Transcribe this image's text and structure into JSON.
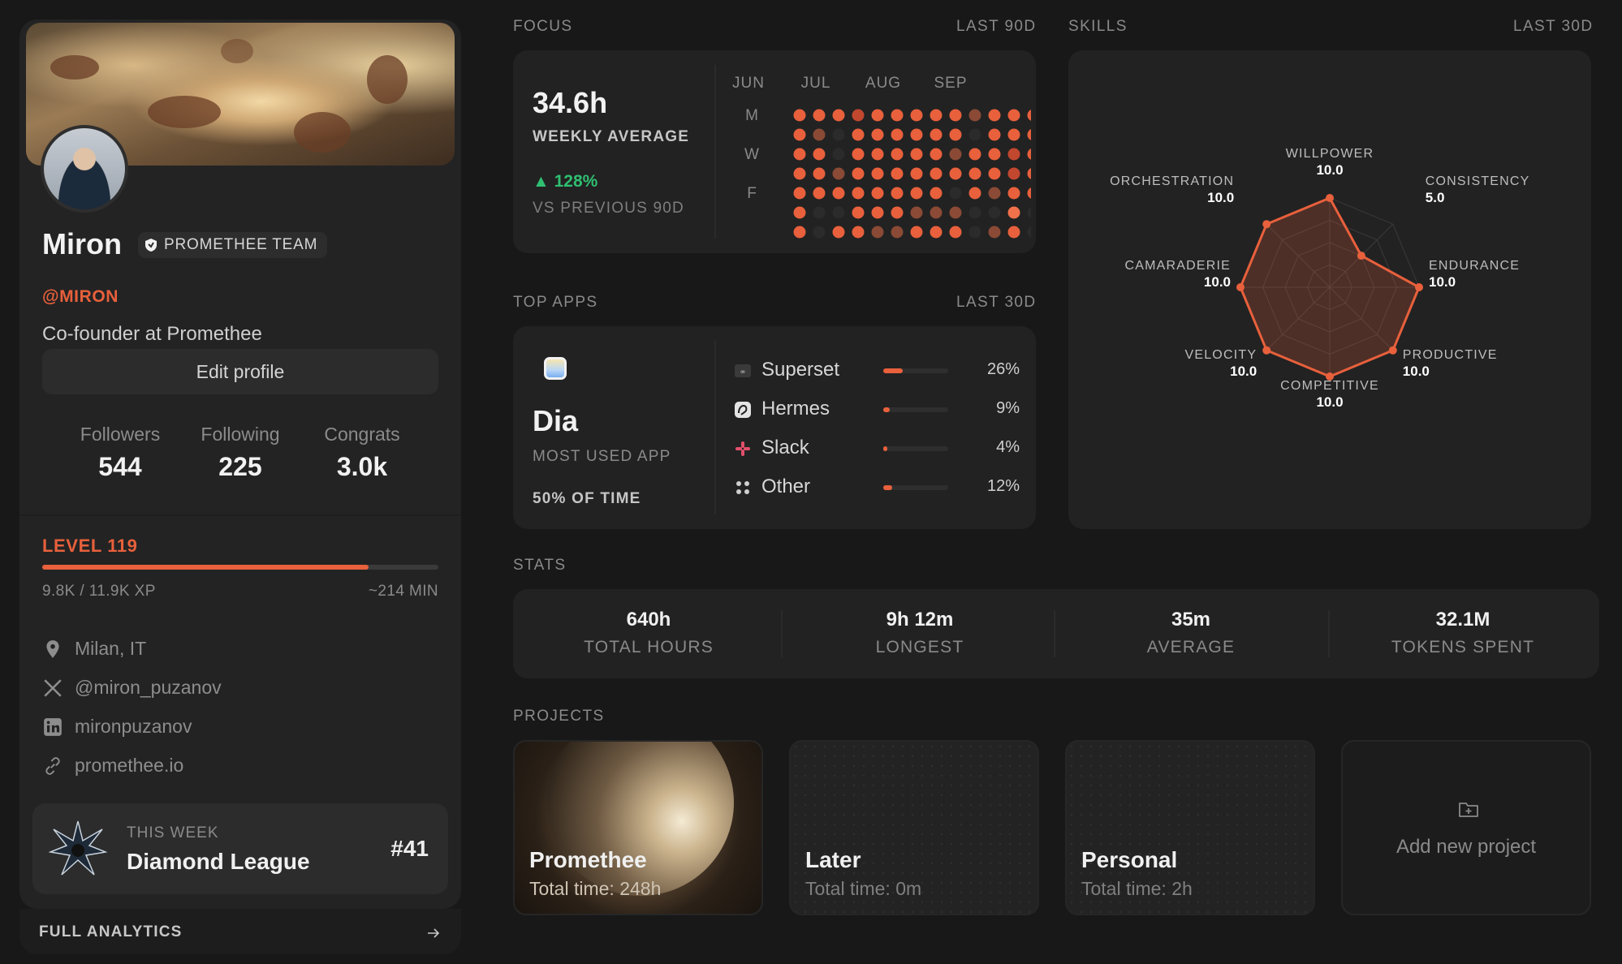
{
  "profile": {
    "name": "Miron",
    "team": "PROMETHEE TEAM",
    "handle": "@MIRON",
    "bio": "Co-founder at Promethee",
    "edit_label": "Edit profile",
    "stats": [
      {
        "label": "Followers",
        "value": "544"
      },
      {
        "label": "Following",
        "value": "225"
      },
      {
        "label": "Congrats",
        "value": "3.0k"
      }
    ],
    "level": "LEVEL 119",
    "xp_text": "9.8K / 11.9K XP",
    "xp_progress": 0.824,
    "xp_time": "~214 MIN",
    "links": [
      {
        "icon": "location-pin-icon",
        "text": "Milan, IT"
      },
      {
        "icon": "x-logo-icon",
        "text": "@miron_puzanov"
      },
      {
        "icon": "linkedin-icon",
        "text": "mironpuzanov"
      },
      {
        "icon": "link-icon",
        "text": "promethee.io"
      }
    ],
    "league": {
      "kicker": "THIS WEEK",
      "name": "Diamond League",
      "rank": "#41"
    },
    "analytics_label": "FULL ANALYTICS"
  },
  "focus": {
    "title": "FOCUS",
    "range": "LAST 90D",
    "value": "34.6h",
    "label": "WEEKLY AVERAGE",
    "delta": "▲ 128%",
    "compare": "VS PREVIOUS 90D",
    "months": [
      "JUN",
      "JUL",
      "AUG",
      "SEP"
    ],
    "day_labels": [
      "M",
      "",
      "W",
      "",
      "F",
      ""
    ],
    "grid": [
      [
        3,
        3,
        3,
        2,
        3,
        3,
        3,
        3,
        3,
        1,
        3,
        3,
        3
      ],
      [
        3,
        1,
        0,
        3,
        3,
        3,
        3,
        3,
        3,
        0,
        3,
        3,
        3
      ],
      [
        3,
        3,
        0,
        3,
        3,
        3,
        3,
        3,
        1,
        3,
        3,
        2,
        3
      ],
      [
        3,
        3,
        1,
        3,
        3,
        3,
        3,
        3,
        3,
        3,
        3,
        2,
        3
      ],
      [
        3,
        3,
        3,
        3,
        3,
        3,
        3,
        3,
        0,
        3,
        1,
        3,
        3
      ],
      [
        3,
        0,
        0,
        3,
        3,
        3,
        1,
        1,
        1,
        0,
        0,
        4,
        0
      ],
      [
        3,
        0,
        3,
        3,
        1,
        1,
        3,
        3,
        3,
        0,
        1,
        3,
        0
      ]
    ],
    "colors": [
      "#2b2b2b",
      "#8a4a35",
      "#c2472f",
      "#e8603c",
      "#f1714a"
    ]
  },
  "top_apps": {
    "title": "TOP APPS",
    "range": "LAST 30D",
    "top_name": "Dia",
    "top_label": "MOST USED APP",
    "top_share": "50% OF TIME",
    "apps": [
      {
        "name": "Superset",
        "pct": "26%",
        "value": 0.26,
        "icon": "superset-icon"
      },
      {
        "name": "Hermes",
        "pct": "9%",
        "value": 0.09,
        "icon": "hermes-icon"
      },
      {
        "name": "Slack",
        "pct": "4%",
        "value": 0.04,
        "icon": "slack-icon"
      },
      {
        "name": "Other",
        "pct": "12%",
        "value": 0.12,
        "icon": "other-apps-icon"
      }
    ]
  },
  "skills": {
    "title": "SKILLS",
    "range": "LAST 30D",
    "axes": [
      {
        "name": "WILLPOWER",
        "value": "10.0",
        "v": 10
      },
      {
        "name": "CONSISTENCY",
        "value": "5.0",
        "v": 5
      },
      {
        "name": "ENDURANCE",
        "value": "10.0",
        "v": 10
      },
      {
        "name": "PRODUCTIVE",
        "value": "10.0",
        "v": 10
      },
      {
        "name": "COMPETITIVE",
        "value": "10.0",
        "v": 10
      },
      {
        "name": "VELOCITY",
        "value": "10.0",
        "v": 10
      },
      {
        "name": "CAMARADERIE",
        "value": "10.0",
        "v": 10
      },
      {
        "name": "ORCHESTRATION",
        "value": "10.0",
        "v": 10
      }
    ],
    "max": 10
  },
  "stats": {
    "title": "STATS",
    "items": [
      {
        "value": "640h",
        "label": "TOTAL HOURS"
      },
      {
        "value": "9h 12m",
        "label": "LONGEST"
      },
      {
        "value": "35m",
        "label": "AVERAGE"
      },
      {
        "value": "32.1M",
        "label": "TOKENS SPENT"
      }
    ]
  },
  "projects": {
    "title": "PROJECTS",
    "items": [
      {
        "name": "Promethee",
        "time": "Total time: 248h"
      },
      {
        "name": "Later",
        "time": "Total time: 0m"
      },
      {
        "name": "Personal",
        "time": "Total time: 2h"
      }
    ],
    "add_label": "Add new project"
  },
  "colors": {
    "accent": "#e8603c",
    "positive": "#2fbf71",
    "background": "#181818",
    "panel": "#222222"
  }
}
